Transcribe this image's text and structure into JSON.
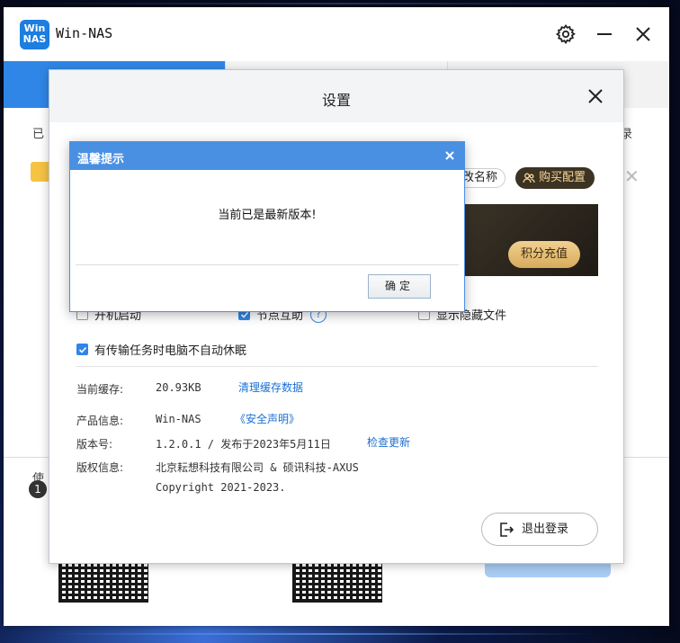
{
  "app": {
    "title": "Win-NAS",
    "logo_line1": "Win",
    "logo_line2": "NAS"
  },
  "background": {
    "partial_text_left": "已",
    "partial_text_right": "录",
    "bottom_label": "使"
  },
  "bottom": {
    "step_number": "1"
  },
  "settings": {
    "title": "设置",
    "rename_label": "改名称",
    "buy_label": "购买配置",
    "recharge_label": "积分充值",
    "checkboxes": {
      "startup": "开机启动",
      "p2p": "节点互助",
      "show_hidden": "显示隐藏文件",
      "no_sleep": "有传输任务时电脑不自动休眠"
    },
    "cache": {
      "label": "当前缓存:",
      "value": "20.93KB",
      "action": "清理缓存数据"
    },
    "product": {
      "label": "产品信息:",
      "value": "Win-NAS",
      "action": "《安全声明》"
    },
    "version": {
      "label": "版本号:",
      "value": "1.2.0.1 / 发布于2023年5月11日",
      "action": "检查更新"
    },
    "copyright": {
      "label": "版权信息:",
      "line1": "北京耘想科技有限公司 & 硕讯科技-AXUS",
      "line2": "Copyright 2021-2023."
    },
    "logout_label": "退出登录"
  },
  "tip": {
    "title": "温馨提示",
    "message": "当前已是最新版本!",
    "ok_label": "确定"
  },
  "colors": {
    "accent": "#2f86e6",
    "tip_header": "#4a90e2",
    "link": "#1a6fd0"
  }
}
